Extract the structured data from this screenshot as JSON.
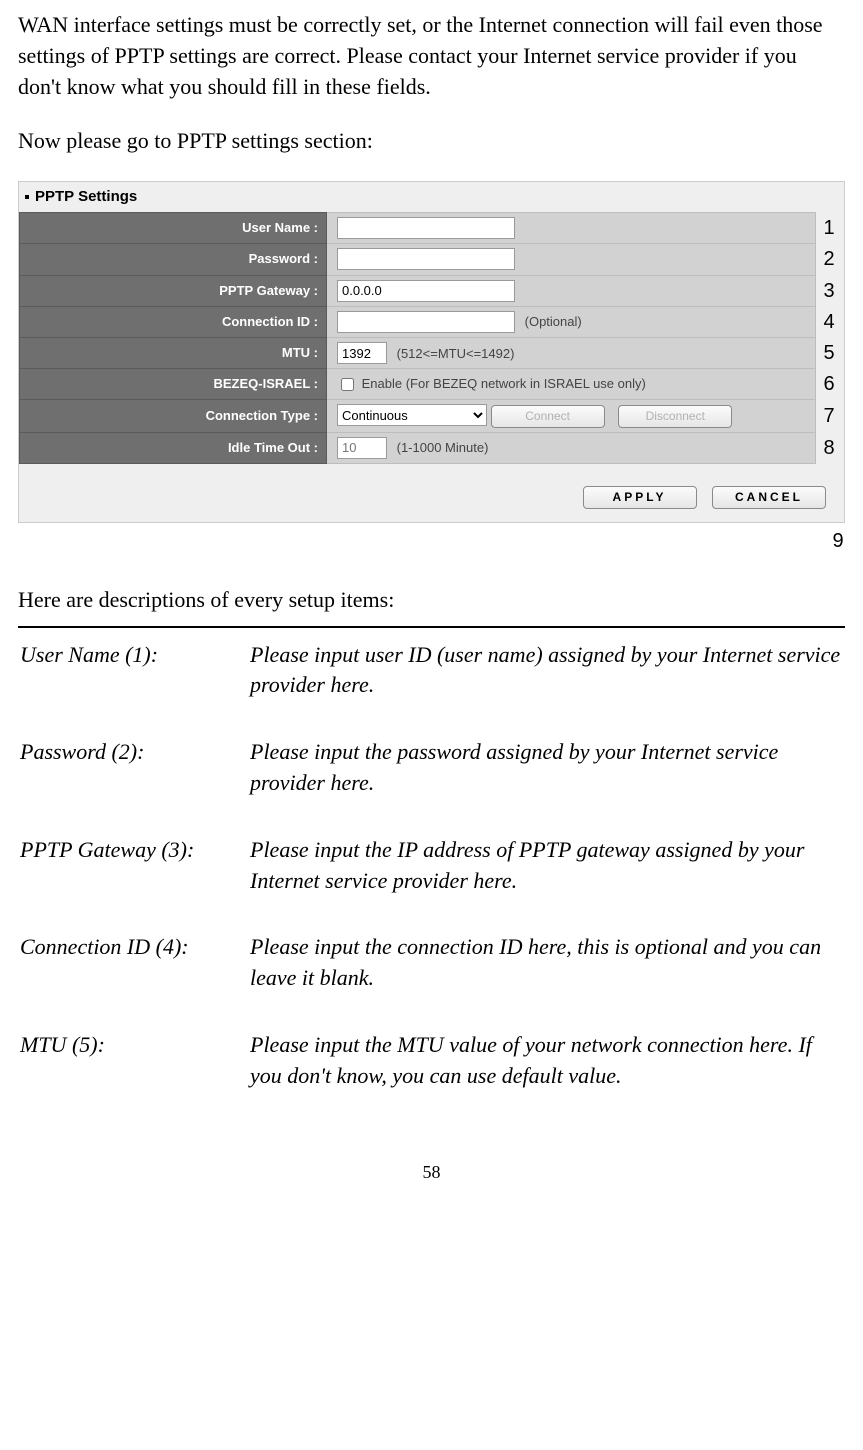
{
  "intro": "WAN interface settings must be correctly set, or the Internet connection will fail even those settings of PPTP settings are correct. Please contact your Internet service provider if you don't know what you should fill in these fields.",
  "nowgo": "Now please go to PPTP settings section:",
  "box_title": "PPTP Settings",
  "labels": {
    "user": "User Name :",
    "pass": "Password :",
    "gw": "PPTP Gateway :",
    "cid": "Connection ID :",
    "mtu": "MTU :",
    "bezeq": "BEZEQ-ISRAEL :",
    "ctype": "Connection Type :",
    "idle": "Idle Time Out :"
  },
  "values": {
    "user": "",
    "pass": "",
    "gw": "0.0.0.0",
    "cid": "",
    "mtu": "1392",
    "ctype": "Continuous",
    "idle": "10"
  },
  "hints": {
    "cid": "(Optional)",
    "mtu": "(512<=MTU<=1492)",
    "bezeq": "Enable (For BEZEQ network in ISRAEL use only)",
    "idle": "(1-1000 Minute)"
  },
  "buttons": {
    "connect": "Connect",
    "disconnect": "Disconnect",
    "apply": "APPLY",
    "cancel": "CANCEL"
  },
  "annot": {
    "1": "1",
    "2": "2",
    "3": "3",
    "4": "4",
    "5": "5",
    "6": "6",
    "7": "7",
    "8": "8",
    "9": "9"
  },
  "desc_head": "Here are descriptions of every setup items:",
  "defs": {
    "t1": "User Name (1):",
    "d1": "Please input user ID (user name) assigned by your Internet service provider here.",
    "t2": "Password (2):",
    "d2": "Please input the password assigned by your Internet service provider here.",
    "t3": "PPTP Gateway (3):",
    "d3": "Please input the IP address of PPTP gateway assigned by your Internet service provider here.",
    "t4": "Connection ID (4):",
    "d4": "Please input the connection ID here, this is optional and you can leave it blank.",
    "t5": "MTU (5):",
    "d5": "Please input the MTU value of your network connection here. If you don't know, you can use default value."
  },
  "pageno": "58"
}
